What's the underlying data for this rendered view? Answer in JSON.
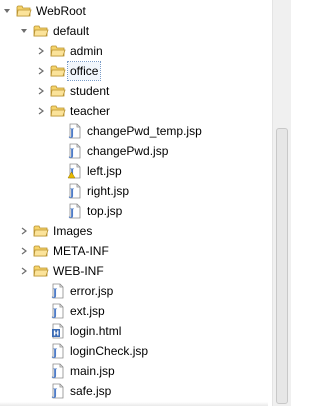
{
  "tree": {
    "nodes": [
      {
        "label": "WebRoot",
        "type": "folder",
        "expander": "expanded",
        "depth": 0
      },
      {
        "label": "default",
        "type": "folder",
        "expander": "expanded",
        "depth": 1
      },
      {
        "label": "admin",
        "type": "folder",
        "expander": "collapsed",
        "depth": 2
      },
      {
        "label": "office",
        "type": "folder",
        "expander": "collapsed",
        "depth": 2,
        "selected": true
      },
      {
        "label": "student",
        "type": "folder",
        "expander": "collapsed",
        "depth": 2
      },
      {
        "label": "teacher",
        "type": "folder",
        "expander": "collapsed",
        "depth": 2
      },
      {
        "label": "changePwd_temp.jsp",
        "type": "jsp",
        "expander": "none",
        "depth": 3
      },
      {
        "label": "changePwd.jsp",
        "type": "jsp",
        "expander": "none",
        "depth": 3
      },
      {
        "label": "left.jsp",
        "type": "jsp-warning",
        "expander": "none",
        "depth": 3
      },
      {
        "label": "right.jsp",
        "type": "jsp",
        "expander": "none",
        "depth": 3
      },
      {
        "label": "top.jsp",
        "type": "jsp",
        "expander": "none",
        "depth": 3
      },
      {
        "label": "Images",
        "type": "folder",
        "expander": "collapsed",
        "depth": 1
      },
      {
        "label": "META-INF",
        "type": "folder",
        "expander": "collapsed",
        "depth": 1
      },
      {
        "label": "WEB-INF",
        "type": "folder",
        "expander": "collapsed",
        "depth": 1
      },
      {
        "label": "error.jsp",
        "type": "jsp",
        "expander": "none",
        "depth": 2
      },
      {
        "label": "ext.jsp",
        "type": "jsp",
        "expander": "none",
        "depth": 2
      },
      {
        "label": "login.html",
        "type": "html",
        "expander": "none",
        "depth": 2
      },
      {
        "label": "loginCheck.jsp",
        "type": "jsp",
        "expander": "none",
        "depth": 2
      },
      {
        "label": "main.jsp",
        "type": "jsp",
        "expander": "none",
        "depth": 2
      },
      {
        "label": "safe.jsp",
        "type": "jsp",
        "expander": "none",
        "depth": 2
      }
    ]
  },
  "icons": {
    "folder": "folder-icon",
    "jsp": "jsp-file-icon",
    "jsp-warning": "jsp-file-warning-icon",
    "html": "html-file-icon",
    "expanded": "expanded-arrow-icon",
    "collapsed": "collapsed-arrow-icon"
  },
  "colors": {
    "folder_fill": "#f5d36b",
    "folder_stroke": "#b8912e",
    "jsp_badge": "#4f7cc7",
    "html_badge": "#3b6bb5",
    "warning": "#e6b800",
    "selection_bg": "#f1f6fc",
    "selection_border": "#7a9cc8",
    "arrow": "#6e6e6e"
  }
}
